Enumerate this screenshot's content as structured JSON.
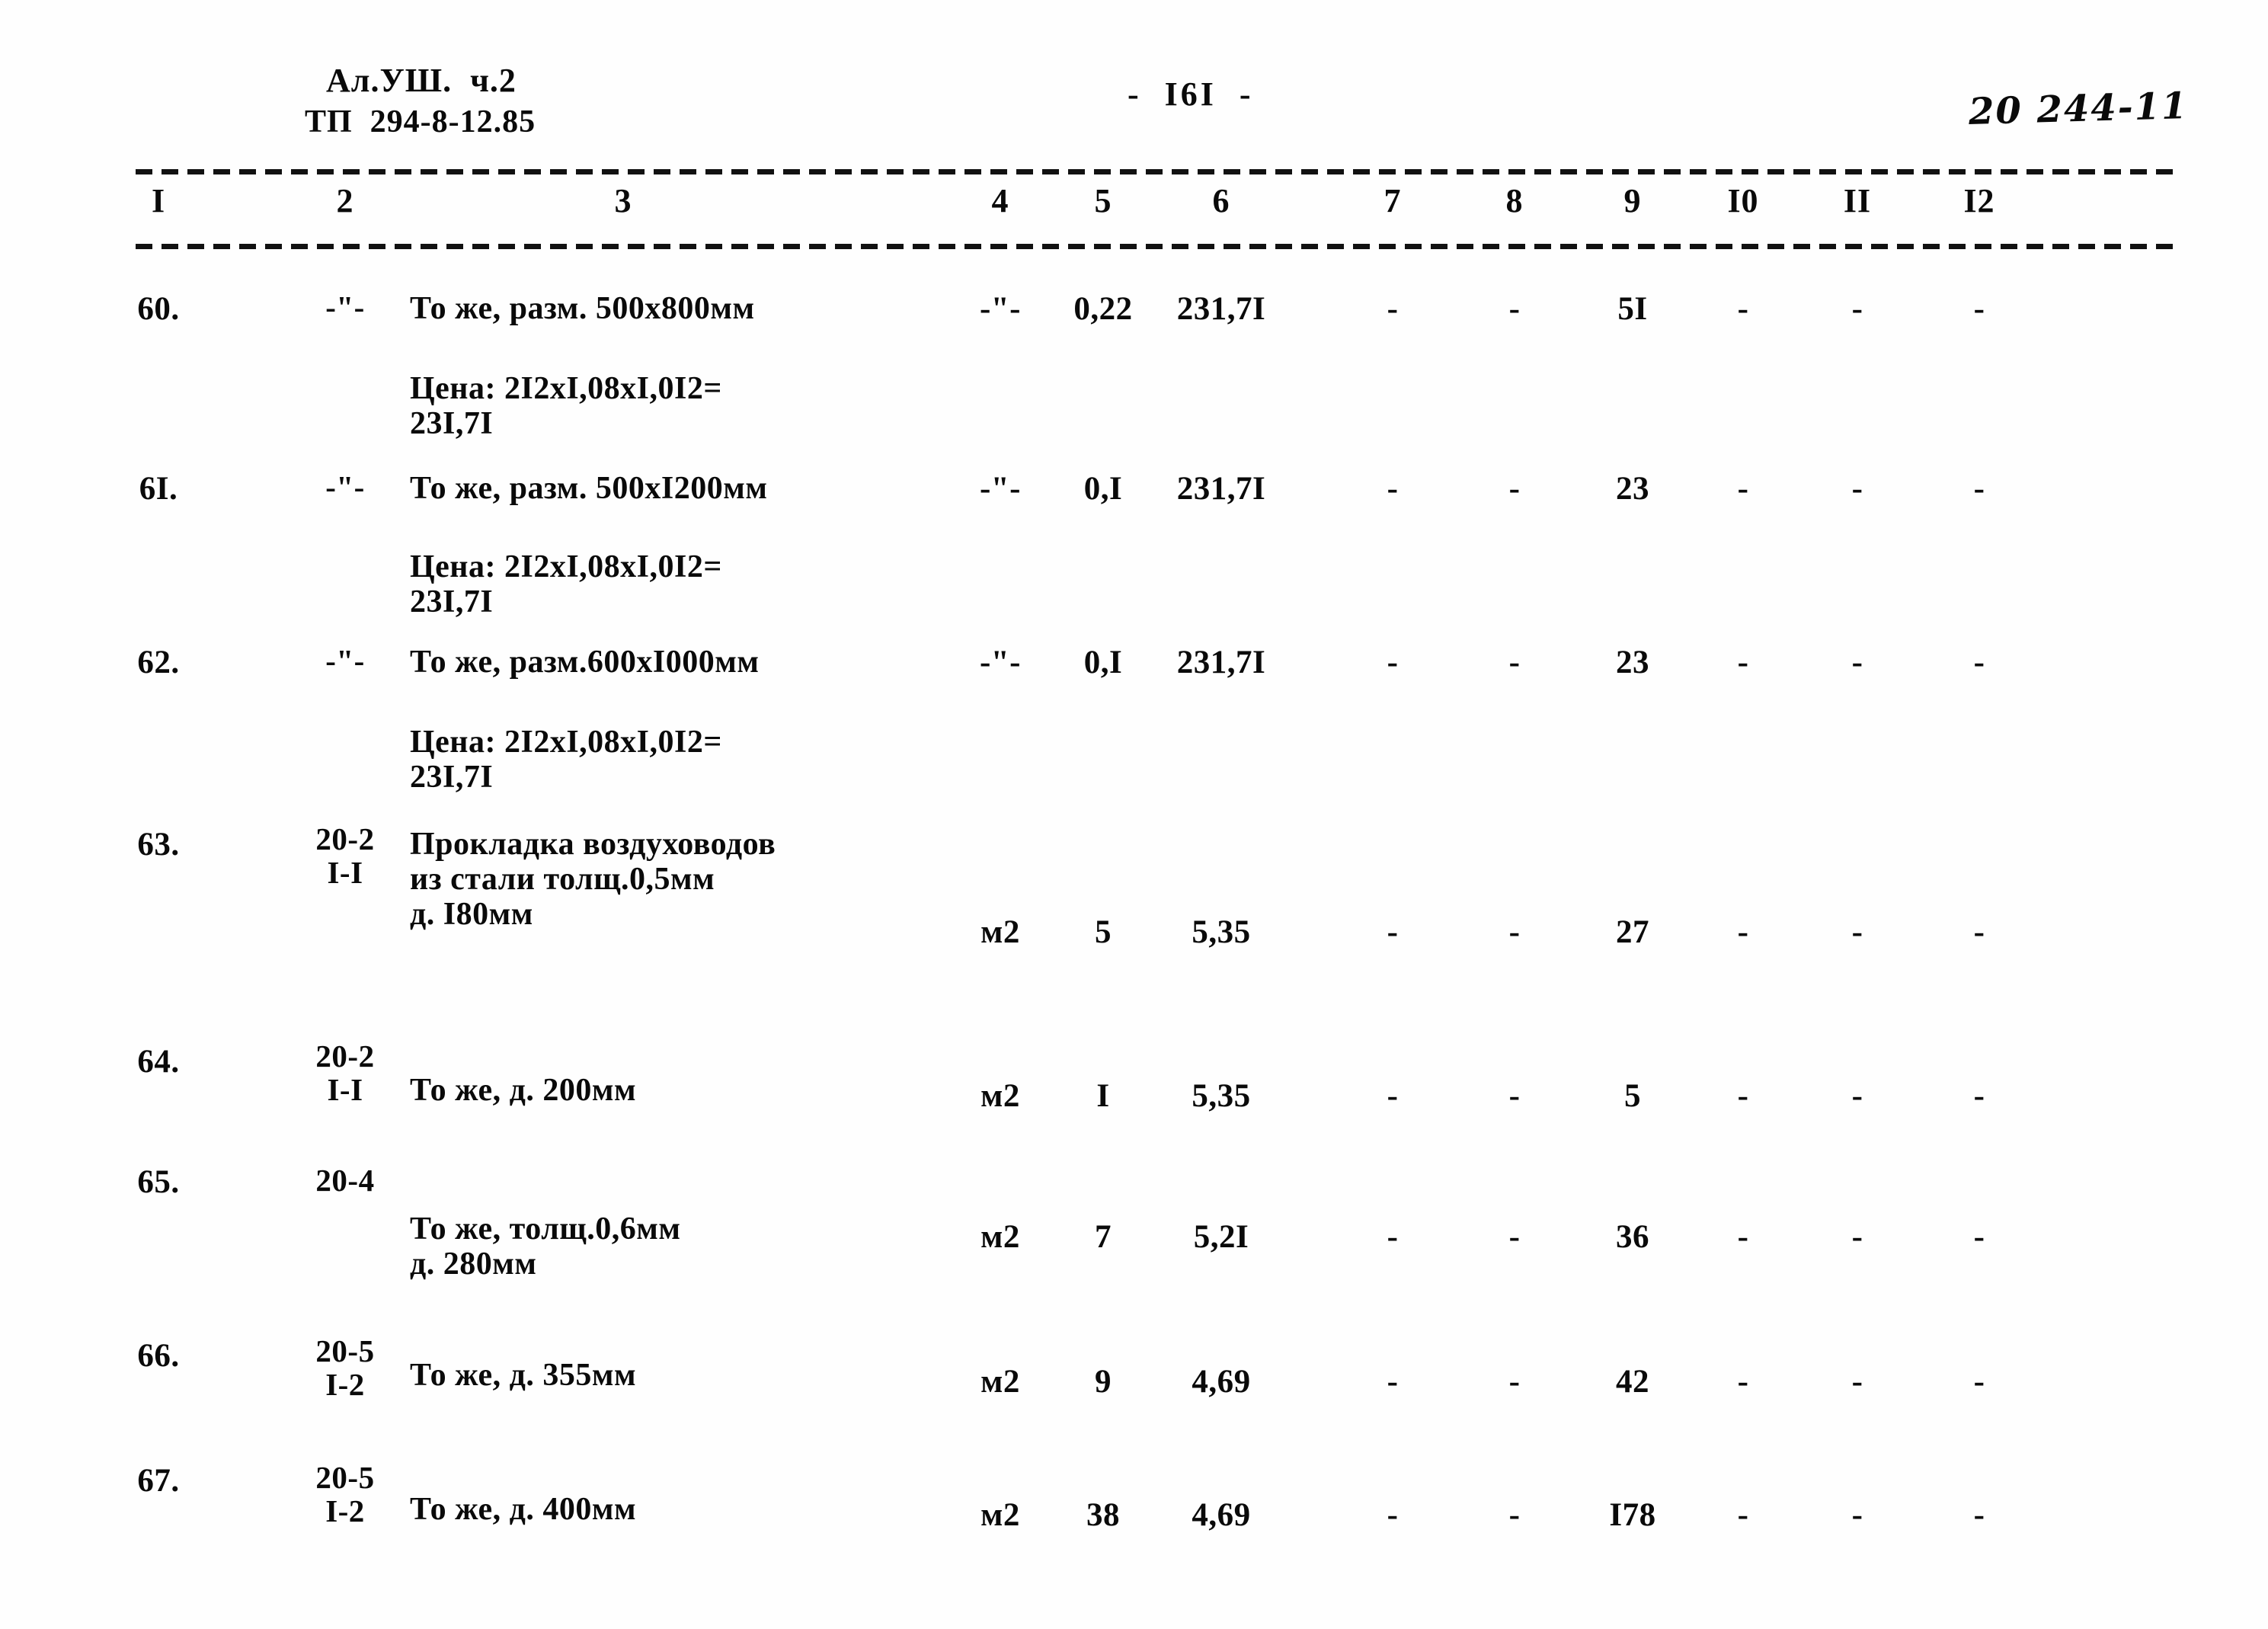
{
  "header": {
    "album_line": "Ал.УШ.  ч.2",
    "project_line": "ТП  294-8-12.85",
    "page_number": "-  I6I  -",
    "doc_number": "20 244-11"
  },
  "table": {
    "column_headers": [
      "I",
      "2",
      "3",
      "4",
      "5",
      "6",
      "7",
      "8",
      "9",
      "I0",
      "II",
      "I2"
    ],
    "rows": [
      {
        "no": "60.",
        "code": "-\"-",
        "desc": "То же, разм. 500х800мм",
        "unit": "-\"-",
        "qty": "0,22",
        "price": "231,7I",
        "c7": "-",
        "c8": "-",
        "c9": "5I",
        "c10": "-",
        "c11": "-",
        "c12": "-",
        "note_l1": "Цена: 2I2хI,08хI,0I2=",
        "note_l2": "23I,7I"
      },
      {
        "no": "6I.",
        "code": "-\"-",
        "desc": "То же, разм. 500хI200мм",
        "unit": "-\"-",
        "qty": "0,I",
        "price": "231,7I",
        "c7": "-",
        "c8": "-",
        "c9": "23",
        "c10": "-",
        "c11": "-",
        "c12": "-",
        "note_l1": "Цена: 2I2хI,08хI,0I2=",
        "note_l2": "23I,7I"
      },
      {
        "no": "62.",
        "code": "-\"-",
        "desc": "То же, разм.600хI000мм",
        "unit": "-\"-",
        "qty": "0,I",
        "price": "231,7I",
        "c7": "-",
        "c8": "-",
        "c9": "23",
        "c10": "-",
        "c11": "-",
        "c12": "-",
        "note_l1": "Цена: 2I2хI,08хI,0I2=",
        "note_l2": "23I,7I"
      },
      {
        "no": "63.",
        "code_l1": "20-2",
        "code_l2": "I-I",
        "desc_l1": "Прокладка воздуховодов",
        "desc_l2": "из стали толщ.0,5мм",
        "desc_l3": "д. I80мм",
        "unit": "м2",
        "qty": "5",
        "price": "5,35",
        "c7": "-",
        "c8": "-",
        "c9": "27",
        "c10": "-",
        "c11": "-",
        "c12": "-"
      },
      {
        "no": "64.",
        "code_l1": "20-2",
        "code_l2": "I-I",
        "desc": "То же, д. 200мм",
        "unit": "м2",
        "qty": "I",
        "price": "5,35",
        "c7": "-",
        "c8": "-",
        "c9": "5",
        "c10": "-",
        "c11": "-",
        "c12": "-"
      },
      {
        "no": "65.",
        "code_l1": "20-4",
        "desc_l1": "То же, толщ.0,6мм",
        "desc_l2": "д. 280мм",
        "unit": "м2",
        "qty": "7",
        "price": "5,2I",
        "c7": "-",
        "c8": "-",
        "c9": "36",
        "c10": "-",
        "c11": "-",
        "c12": "-"
      },
      {
        "no": "66.",
        "code_l1": "20-5",
        "code_l2": "I-2",
        "desc": "То же, д. 355мм",
        "unit": "м2",
        "qty": "9",
        "price": "4,69",
        "c7": "-",
        "c8": "-",
        "c9": "42",
        "c10": "-",
        "c11": "-",
        "c12": "-"
      },
      {
        "no": "67.",
        "code_l1": "20-5",
        "code_l2": "I-2",
        "desc": "То же, д. 400мм",
        "unit": "м2",
        "qty": "38",
        "price": "4,69",
        "c7": "-",
        "c8": "-",
        "c9": "I78",
        "c10": "-",
        "c11": "-",
        "c12": "-"
      }
    ]
  }
}
